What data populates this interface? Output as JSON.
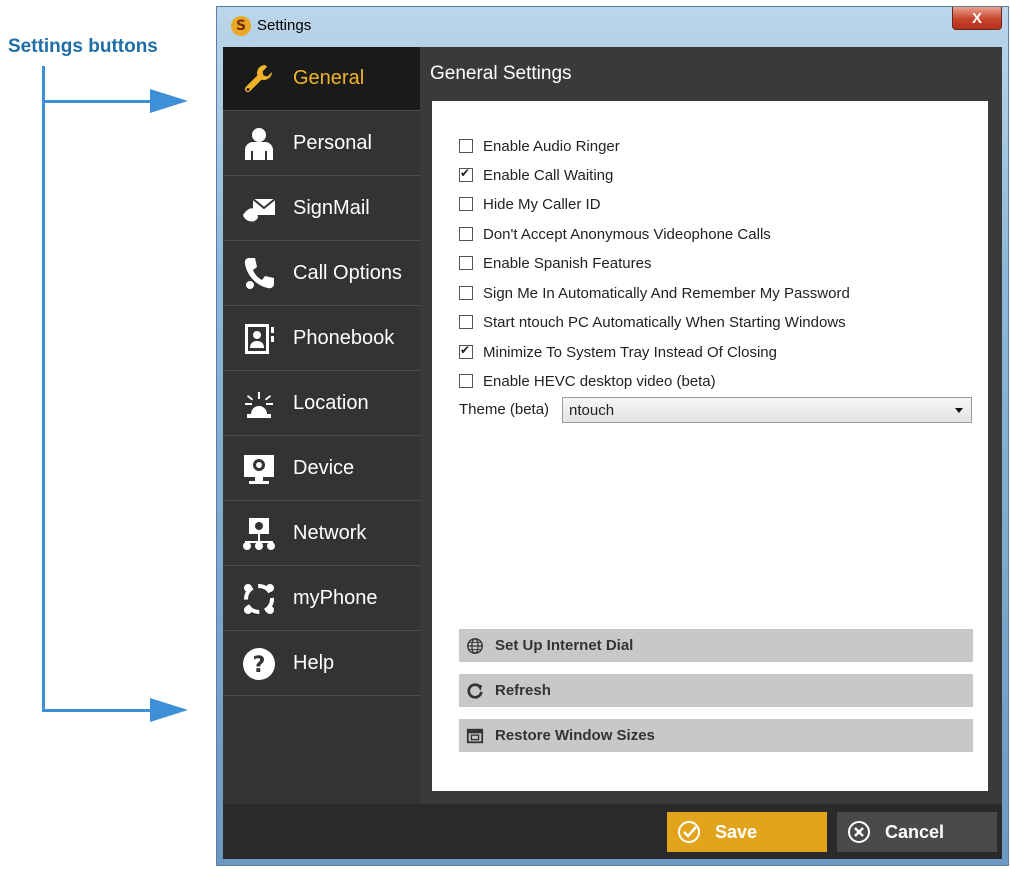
{
  "annotation": {
    "label": "Settings buttons"
  },
  "window": {
    "title": "Settings",
    "close_label": "X",
    "app_icon_letter": "S"
  },
  "sidebar": {
    "items": [
      {
        "label": "General",
        "icon": "wrench-icon",
        "active": true
      },
      {
        "label": "Personal",
        "icon": "person-icon",
        "active": false
      },
      {
        "label": "SignMail",
        "icon": "signmail-icon",
        "active": false
      },
      {
        "label": "Call Options",
        "icon": "call-options-icon",
        "active": false
      },
      {
        "label": "Phonebook",
        "icon": "phonebook-icon",
        "active": false
      },
      {
        "label": "Location",
        "icon": "location-icon",
        "active": false
      },
      {
        "label": "Device",
        "icon": "device-icon",
        "active": false
      },
      {
        "label": "Network",
        "icon": "network-icon",
        "active": false
      },
      {
        "label": "myPhone",
        "icon": "myphone-icon",
        "active": false
      },
      {
        "label": "Help",
        "icon": "help-icon",
        "active": false
      }
    ]
  },
  "main": {
    "title": "General Settings",
    "options": [
      {
        "label": "Enable Audio Ringer",
        "checked": false
      },
      {
        "label": "Enable Call Waiting",
        "checked": true
      },
      {
        "label": "Hide My Caller ID",
        "checked": false
      },
      {
        "label": "Don't Accept Anonymous Videophone Calls",
        "checked": false
      },
      {
        "label": "Enable Spanish Features",
        "checked": false
      },
      {
        "label": "Sign Me In Automatically And Remember My Password",
        "checked": false
      },
      {
        "label": "Start ntouch PC Automatically When Starting Windows",
        "checked": false
      },
      {
        "label": "Minimize To System Tray Instead Of Closing",
        "checked": true
      },
      {
        "label": "Enable HEVC desktop video (beta)",
        "checked": false
      }
    ],
    "theme": {
      "label": "Theme (beta)",
      "value": "ntouch"
    },
    "actions": [
      {
        "label": "Set Up Internet Dial",
        "icon": "globe-icon"
      },
      {
        "label": "Refresh",
        "icon": "refresh-icon"
      },
      {
        "label": "Restore Window Sizes",
        "icon": "window-icon"
      }
    ]
  },
  "footer": {
    "save_label": "Save",
    "cancel_label": "Cancel"
  },
  "colors": {
    "accent": "#f0b429",
    "save": "#e2a41c",
    "sidebar": "#333333",
    "callout": "#3d8fd6"
  }
}
